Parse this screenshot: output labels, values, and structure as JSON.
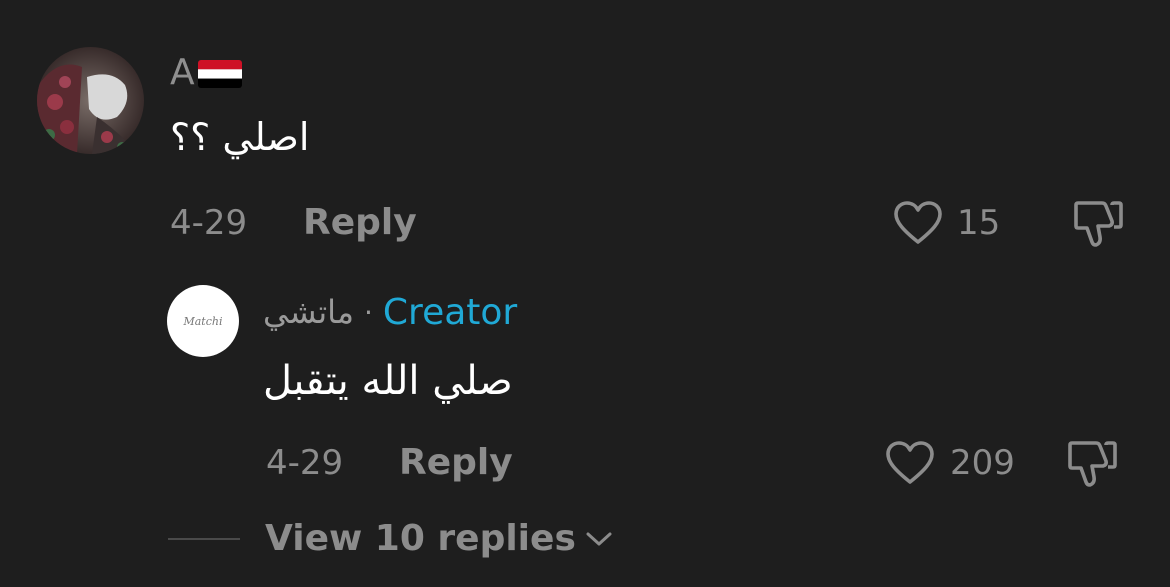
{
  "comment": {
    "username": "A",
    "flag": "yemen-flag",
    "text": "اصلي ؟؟",
    "date": "4-29",
    "reply_label": "Reply",
    "like_count": "15"
  },
  "reply": {
    "avatar_text": "Matchi",
    "username": "ماتشي",
    "separator": "·",
    "creator_label": "Creator",
    "text": "صلي الله يتقبل",
    "date": "4-29",
    "reply_label": "Reply",
    "like_count": "209"
  },
  "view_replies": {
    "label": "View 10 replies"
  },
  "colors": {
    "background": "#1e1e1e",
    "secondary_text": "#8c8c8c",
    "creator_accent": "#20a9d6"
  }
}
